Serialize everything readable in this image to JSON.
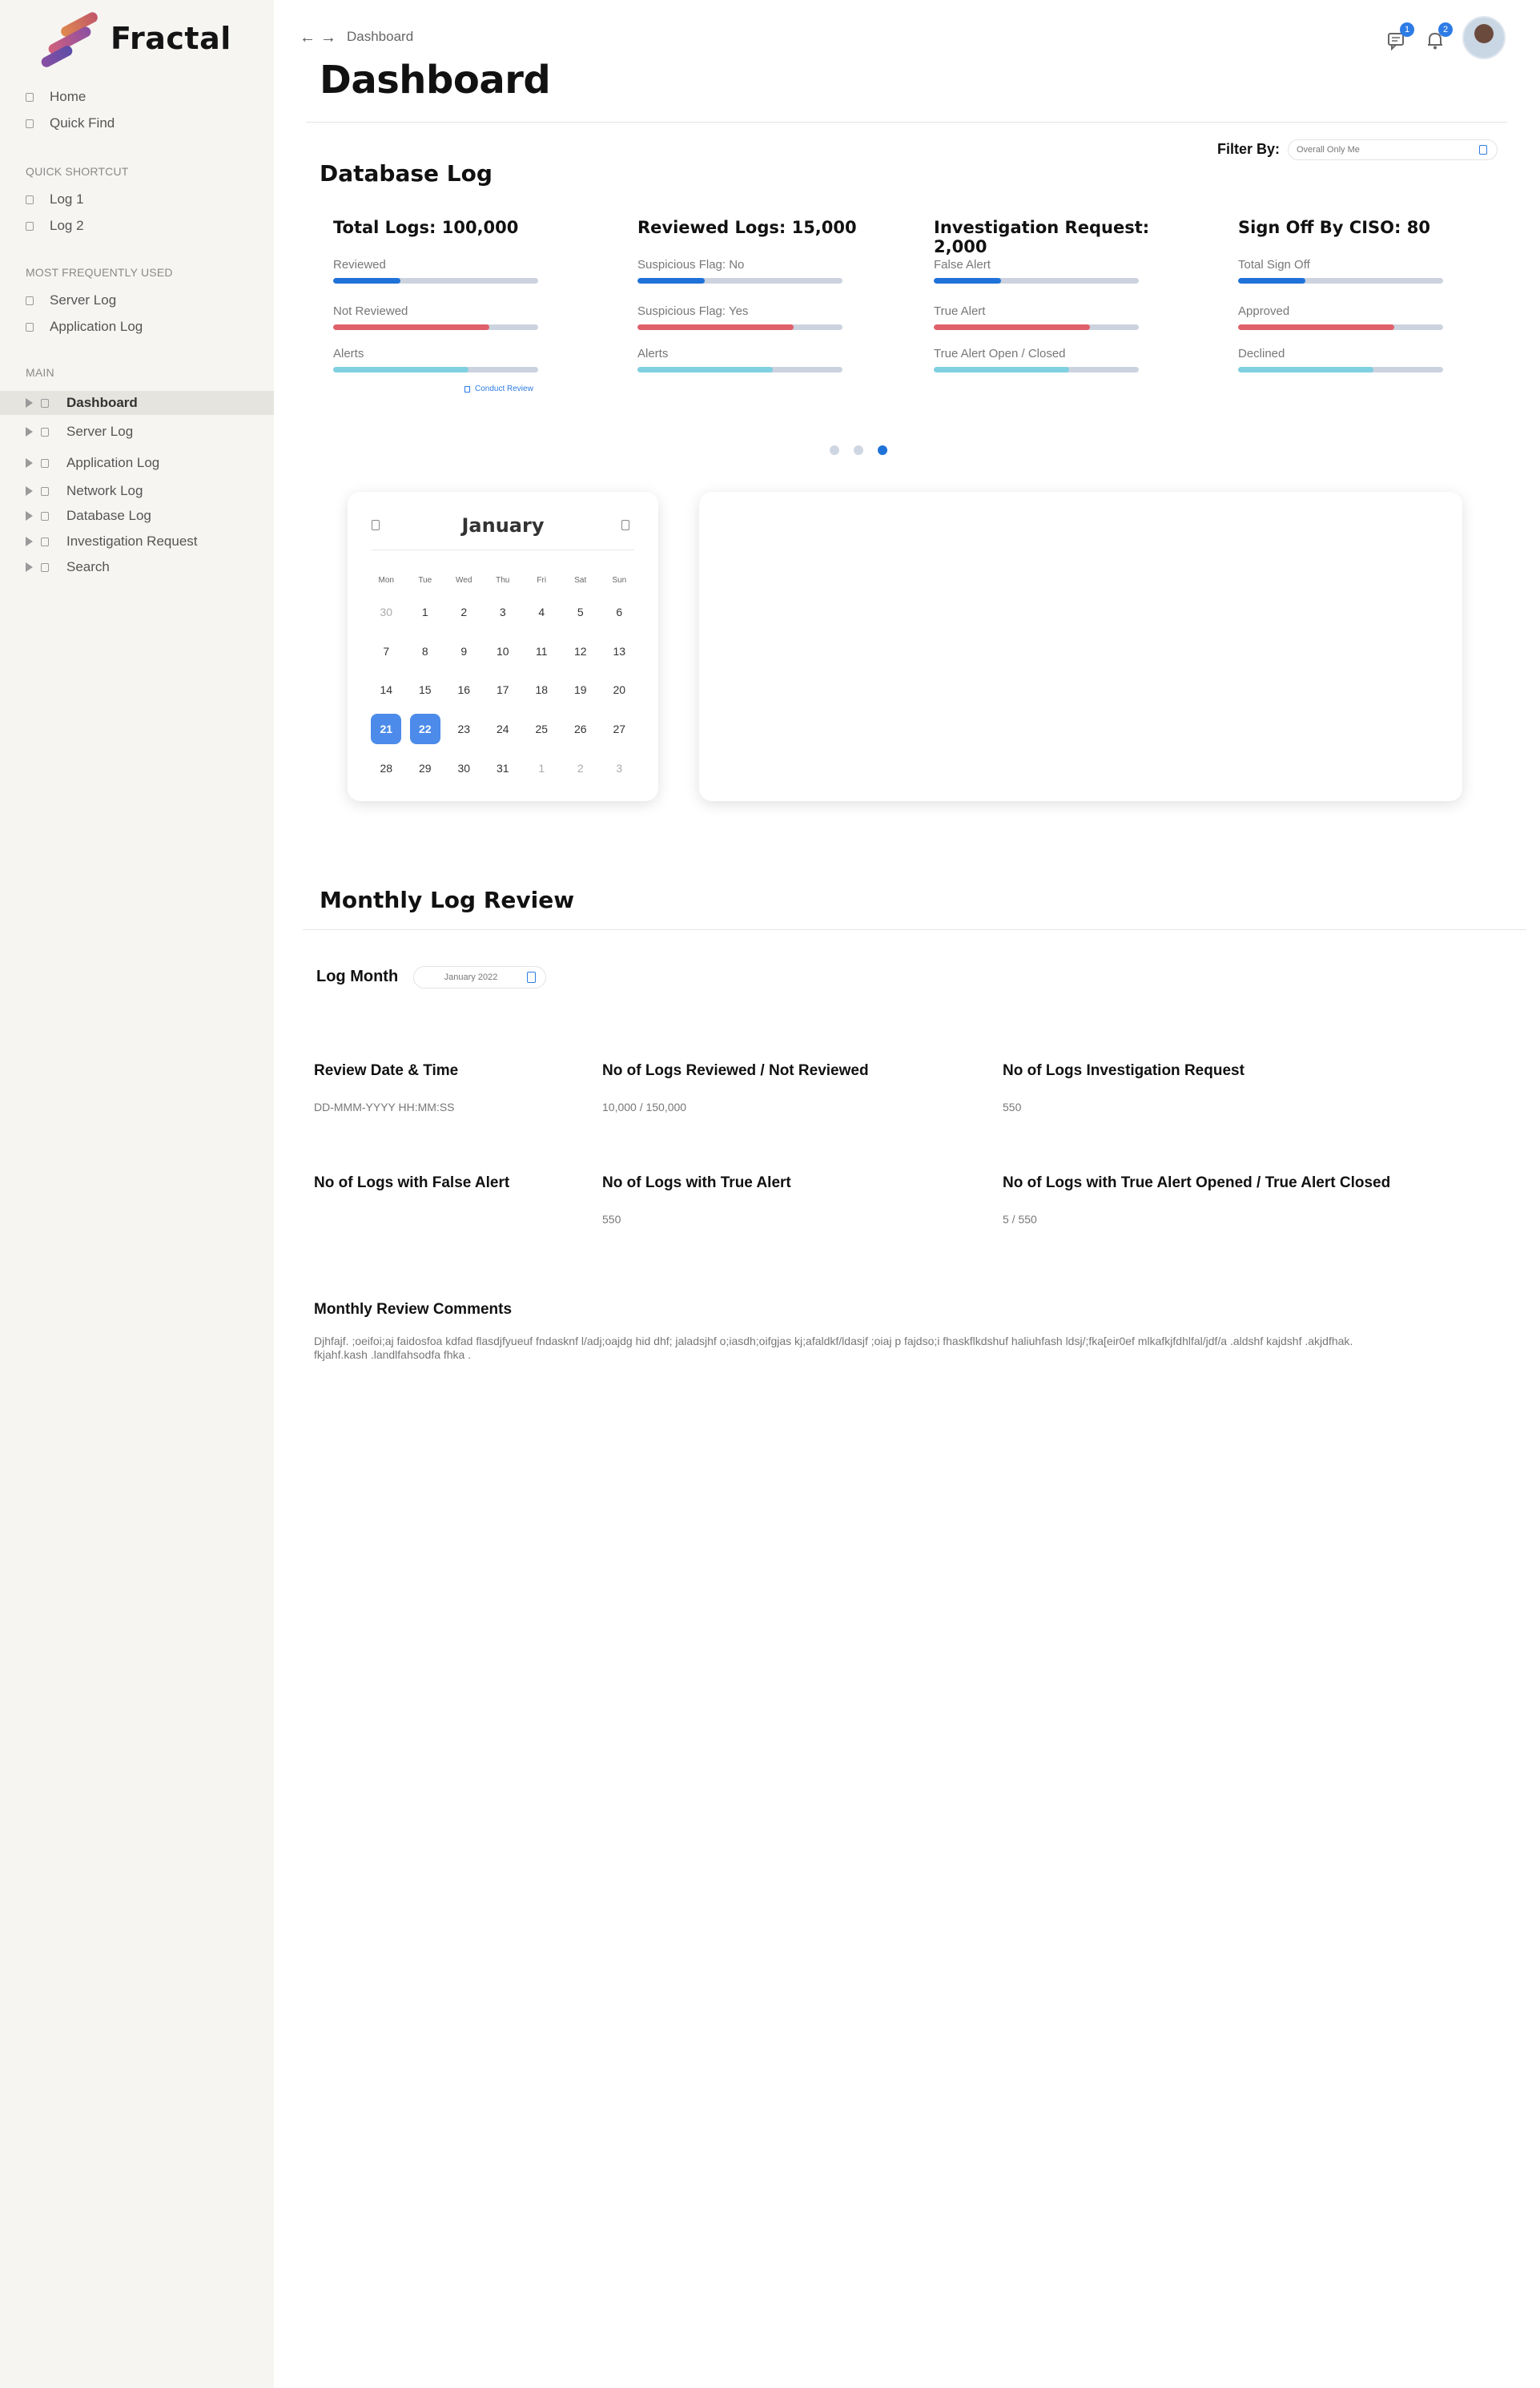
{
  "app": {
    "logo_text": "Fractal",
    "brand_colors": [
      "#e0674d",
      "#8a4fa3",
      "#5a4da8"
    ]
  },
  "sidebar": {
    "top_items": [
      {
        "label": "Home"
      },
      {
        "label": "Quick Find"
      }
    ],
    "quick_shortcut": {
      "title": "QUICK SHORTCUT",
      "items": [
        {
          "label": "Log 1"
        },
        {
          "label": "Log 2"
        }
      ]
    },
    "most_used": {
      "title": "MOST FREQUENTLY USED",
      "items": [
        {
          "label": "Server Log"
        },
        {
          "label": "Application Log"
        }
      ]
    },
    "main": {
      "title": "MAIN",
      "items": [
        {
          "label": "Dashboard",
          "active": true
        },
        {
          "label": "Server Log"
        },
        {
          "label": "Application Log"
        },
        {
          "label": "Network Log"
        },
        {
          "label": "Database Log"
        },
        {
          "label": "Investigation Request"
        },
        {
          "label": "Search"
        }
      ]
    }
  },
  "topbar": {
    "breadcrumb": "Dashboard",
    "messages_badge": "1",
    "notifications_badge": "2",
    "accent": "#2d7be5"
  },
  "page": {
    "title": "Dashboard"
  },
  "database_log": {
    "title": "Database Log",
    "filter_label": "Filter By:",
    "filter_value": "Overall    Only Me",
    "cards": [
      {
        "title": "Total Logs: 100,000",
        "metrics": [
          {
            "label": "Reviewed",
            "fraction": 0.33,
            "color": "#1f72d8"
          },
          {
            "label": "Not Reviewed",
            "fraction": 0.76,
            "color": "#e0606a"
          },
          {
            "label": "Alerts",
            "fraction": 0.66,
            "color": "#7fd0e0"
          }
        ]
      },
      {
        "title": "Reviewed Logs: 15,000",
        "metrics": [
          {
            "label": "Suspicious Flag: No",
            "fraction": 0.33,
            "color": "#1f72d8"
          },
          {
            "label": "Suspicious Flag: Yes",
            "fraction": 0.76,
            "color": "#e0606a"
          },
          {
            "label": "Alerts",
            "fraction": 0.66,
            "color": "#7fd0e0"
          }
        ]
      },
      {
        "title": "Investigation Request: 2,000",
        "metrics": [
          {
            "label": "False Alert",
            "fraction": 0.33,
            "color": "#1f72d8"
          },
          {
            "label": "True Alert",
            "fraction": 0.76,
            "color": "#e0606a"
          },
          {
            "label": "True Alert Open / Closed",
            "fraction": 0.66,
            "color": "#7fd0e0"
          }
        ]
      },
      {
        "title": "Sign Off By CISO: 80",
        "metrics": [
          {
            "label": "Total Sign Off",
            "fraction": 0.33,
            "color": "#1f72d8"
          },
          {
            "label": "Approved",
            "fraction": 0.76,
            "color": "#e0606a"
          },
          {
            "label": "Declined",
            "fraction": 0.66,
            "color": "#7fd0e0"
          }
        ]
      }
    ],
    "conduct_review": "Conduct Review",
    "carousel": {
      "count": 3,
      "active_index": 2
    }
  },
  "calendar": {
    "month": "January",
    "weekdays": [
      "Mon",
      "Tue",
      "Wed",
      "Thu",
      "Fri",
      "Sat",
      "Sun"
    ],
    "days": [
      {
        "d": "30",
        "muted": true
      },
      {
        "d": "1"
      },
      {
        "d": "2"
      },
      {
        "d": "3"
      },
      {
        "d": "4"
      },
      {
        "d": "5"
      },
      {
        "d": "6"
      },
      {
        "d": "7"
      },
      {
        "d": "8"
      },
      {
        "d": "9"
      },
      {
        "d": "10"
      },
      {
        "d": "11"
      },
      {
        "d": "12"
      },
      {
        "d": "13"
      },
      {
        "d": "14"
      },
      {
        "d": "15"
      },
      {
        "d": "16"
      },
      {
        "d": "17"
      },
      {
        "d": "18"
      },
      {
        "d": "19"
      },
      {
        "d": "20"
      },
      {
        "d": "21",
        "selected": true
      },
      {
        "d": "22",
        "selected": true
      },
      {
        "d": "23"
      },
      {
        "d": "24"
      },
      {
        "d": "25"
      },
      {
        "d": "26"
      },
      {
        "d": "27"
      },
      {
        "d": "28"
      },
      {
        "d": "29"
      },
      {
        "d": "30"
      },
      {
        "d": "31"
      },
      {
        "d": "1",
        "muted": true
      },
      {
        "d": "2",
        "muted": true
      },
      {
        "d": "3",
        "muted": true
      }
    ]
  },
  "monthly_review": {
    "title": "Monthly Log Review",
    "log_month_label": "Log Month",
    "log_month_value": "January 2022",
    "fields": [
      {
        "label": "Review Date & Time",
        "value": "DD-MMM-YYYY HH:MM:SS"
      },
      {
        "label": "No of Logs Reviewed / Not Reviewed",
        "value": "10,000 / 150,000"
      },
      {
        "label": "No of Logs Investigation Request",
        "value": "550"
      },
      {
        "label": "No of Logs with False Alert",
        "value": ""
      },
      {
        "label": "No of Logs with True Alert",
        "value": "550"
      },
      {
        "label": "No of Logs with True Alert Opened / True Alert Closed",
        "value": "5 / 550"
      }
    ],
    "comments_label": "Monthly Review Comments",
    "comments": "Djhfajf. ;oeifoi;aj faidosfoa kdfad flasdjfyueuf fndasknf l/adj;oajdg hid dhf; jaladsjhf o;iasdh;oifgjas kj;afaldkf/ldasjf ;oiaj p fajdso;i fhaskflkdshuf haliuhfash ldsj/;fka[eir0ef mlkafkjfdhlfal/jdf/a .aldshf kajdshf .akjdfhak. fkjahf.kash .landlfahsodfa fhka ."
  }
}
